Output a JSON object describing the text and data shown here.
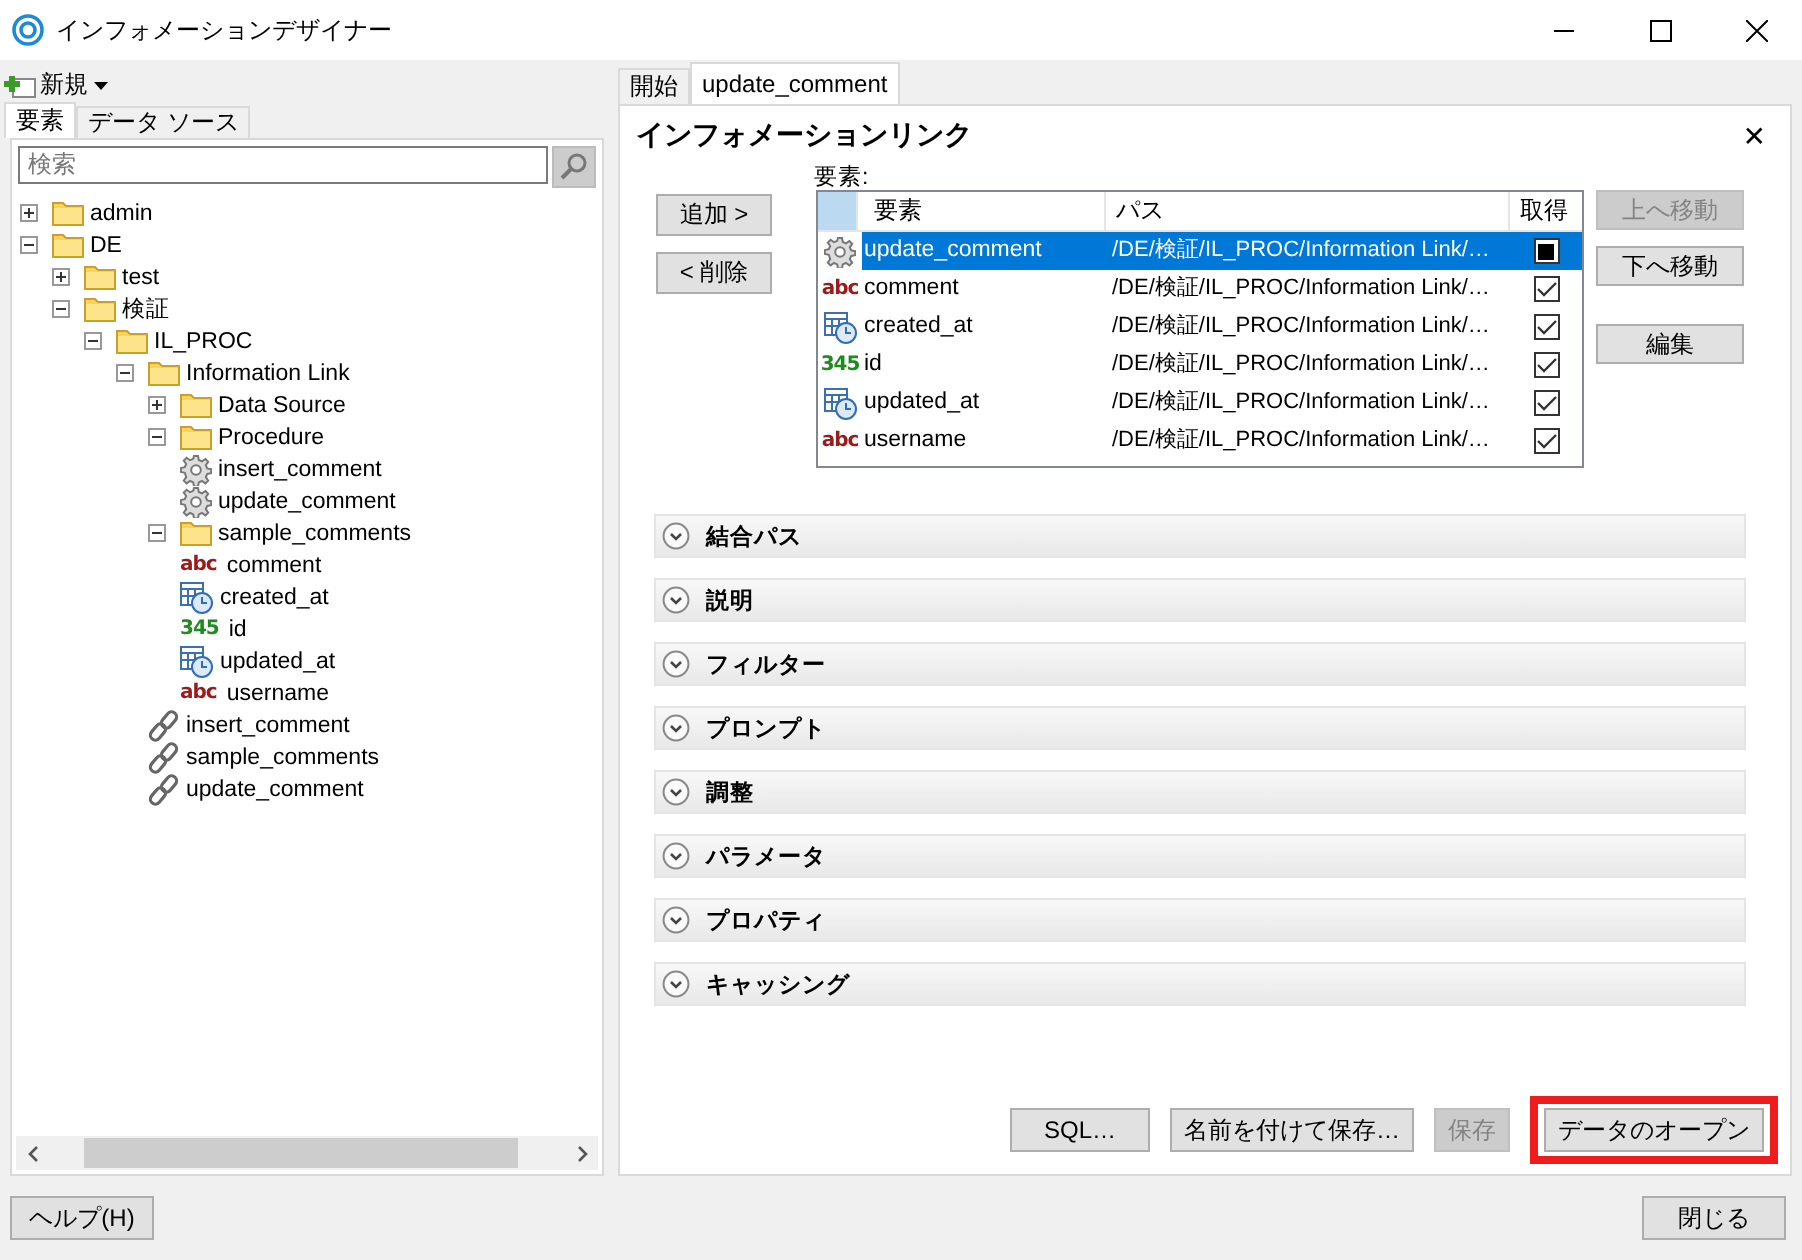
{
  "window": {
    "title": "インフォメーションデザイナー"
  },
  "new_button": {
    "label": "新規"
  },
  "left_tabs": [
    {
      "label": "要素",
      "selected": true
    },
    {
      "label": "データ ソース",
      "selected": false
    }
  ],
  "search": {
    "placeholder": "検索"
  },
  "tree": [
    {
      "label": "admin",
      "kind": "folder",
      "expanded": false
    },
    {
      "label": "DE",
      "kind": "folder",
      "expanded": true,
      "children": [
        {
          "label": "test",
          "kind": "folder",
          "expanded": false
        },
        {
          "label": "検証",
          "kind": "folder",
          "expanded": true,
          "children": [
            {
              "label": "IL_PROC",
              "kind": "folder",
              "expanded": true,
              "children": [
                {
                  "label": "Information Link",
                  "kind": "folder",
                  "expanded": true,
                  "children": [
                    {
                      "label": "Data Source",
                      "kind": "folder",
                      "expanded": false
                    },
                    {
                      "label": "Procedure",
                      "kind": "folder",
                      "expanded": true,
                      "children": [
                        {
                          "label": "insert_comment",
                          "kind": "procedure"
                        },
                        {
                          "label": "update_comment",
                          "kind": "procedure"
                        }
                      ]
                    },
                    {
                      "label": "sample_comments",
                      "kind": "folder",
                      "expanded": true,
                      "children": [
                        {
                          "label": "comment",
                          "kind": "string",
                          "icon_text": "abc"
                        },
                        {
                          "label": "created_at",
                          "kind": "datetime"
                        },
                        {
                          "label": "id",
                          "kind": "integer",
                          "icon_text": "345"
                        },
                        {
                          "label": "updated_at",
                          "kind": "datetime"
                        },
                        {
                          "label": "username",
                          "kind": "string",
                          "icon_text": "abc"
                        }
                      ]
                    },
                    {
                      "label": "insert_comment",
                      "kind": "link"
                    },
                    {
                      "label": "sample_comments",
                      "kind": "link"
                    },
                    {
                      "label": "update_comment",
                      "kind": "link"
                    }
                  ]
                }
              ]
            }
          ]
        }
      ]
    }
  ],
  "doc_tabs": [
    {
      "label": "開始",
      "selected": false
    },
    {
      "label": "update_comment",
      "selected": true
    }
  ],
  "editor": {
    "title": "インフォメーションリンク",
    "close": "✕",
    "elements_label": "要素:",
    "add_button": "追加 >",
    "remove_button": "< 削除",
    "columns": [
      "要素",
      "パス",
      "取得"
    ],
    "rows": [
      {
        "name": "update_comment",
        "kind": "procedure",
        "path": "/DE/検証/IL_PROC/Information Link/…",
        "checked": true,
        "selected": true
      },
      {
        "name": "comment",
        "kind": "string",
        "icon_text": "abc",
        "path": "/DE/検証/IL_PROC/Information Link/…",
        "checked": true,
        "selected": false
      },
      {
        "name": "created_at",
        "kind": "datetime",
        "path": "/DE/検証/IL_PROC/Information Link/…",
        "checked": true,
        "selected": false
      },
      {
        "name": "id",
        "kind": "integer",
        "icon_text": "345",
        "path": "/DE/検証/IL_PROC/Information Link/…",
        "checked": true,
        "selected": false
      },
      {
        "name": "updated_at",
        "kind": "datetime",
        "path": "/DE/検証/IL_PROC/Information Link/…",
        "checked": true,
        "selected": false
      },
      {
        "name": "username",
        "kind": "string",
        "icon_text": "abc",
        "path": "/DE/検証/IL_PROC/Information Link/…",
        "checked": true,
        "selected": false
      }
    ],
    "side_buttons": [
      {
        "label": "上へ移動",
        "disabled": true
      },
      {
        "label": "下へ移動",
        "disabled": false
      },
      {
        "label": "編集",
        "disabled": false
      }
    ],
    "sections": [
      {
        "label": "結合パス",
        "expanded": false
      },
      {
        "label": "説明",
        "expanded": false
      },
      {
        "label": "フィルター",
        "expanded": false
      },
      {
        "label": "プロンプト",
        "expanded": false
      },
      {
        "label": "調整",
        "expanded": false
      },
      {
        "label": "パラメータ",
        "expanded": false
      },
      {
        "label": "プロパティ",
        "expanded": false
      },
      {
        "label": "キャッシング",
        "expanded": false
      }
    ],
    "bottom_buttons": [
      {
        "label": "SQL…",
        "disabled": false,
        "highlighted": false
      },
      {
        "label": "名前を付けて保存…",
        "disabled": false,
        "highlighted": false
      },
      {
        "label": "保存",
        "disabled": true,
        "highlighted": false
      },
      {
        "label": "データのオープン",
        "disabled": false,
        "highlighted": true
      }
    ]
  },
  "footer": {
    "help_button": "ヘルプ(H)",
    "close_button": "閉じる"
  }
}
